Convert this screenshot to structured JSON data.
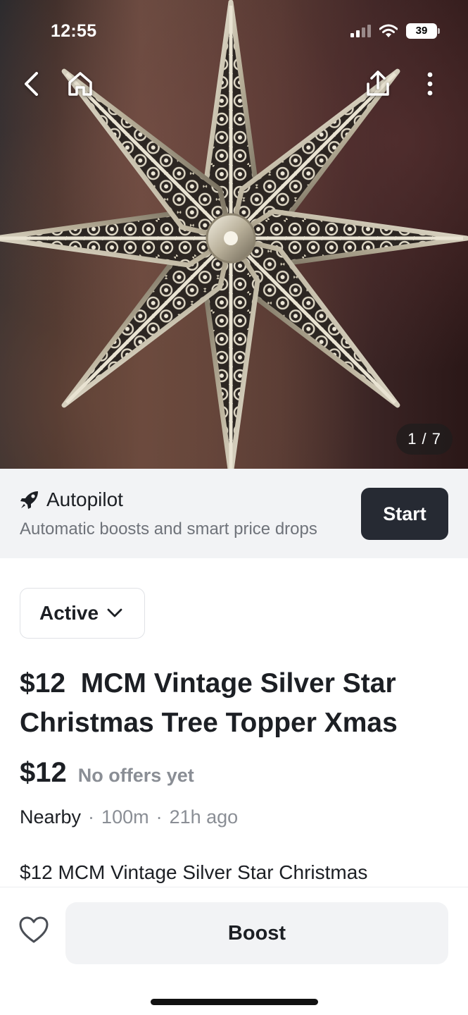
{
  "status_bar": {
    "time": "12:55",
    "battery": "39",
    "icons": [
      "cellular-signal-icon",
      "wifi-icon",
      "battery-icon"
    ]
  },
  "nav": {
    "icons": [
      "chevron-left-icon",
      "home-icon",
      "share-icon",
      "more-vertical-icon"
    ]
  },
  "gallery": {
    "counter": "1 / 7"
  },
  "autopilot": {
    "icon": "rocket-icon",
    "title": "Autopilot",
    "subtitle": "Automatic boosts and smart price drops",
    "button": "Start"
  },
  "listing": {
    "status": "Active",
    "title": "$12  MCM Vintage Silver Star Christmas Tree Topper Xmas",
    "price": "$12",
    "offers": "No offers yet",
    "location": "Nearby",
    "distance": "100m",
    "posted": "21h ago",
    "description": "$12  MCM Vintage Silver Star Christmas"
  },
  "actions": {
    "favorite_icon": "heart-icon",
    "boost": "Boost"
  },
  "colors": {
    "dark_button": "#262a33",
    "banner_bg": "#f2f3f5",
    "muted_text": "#8a8e95"
  }
}
